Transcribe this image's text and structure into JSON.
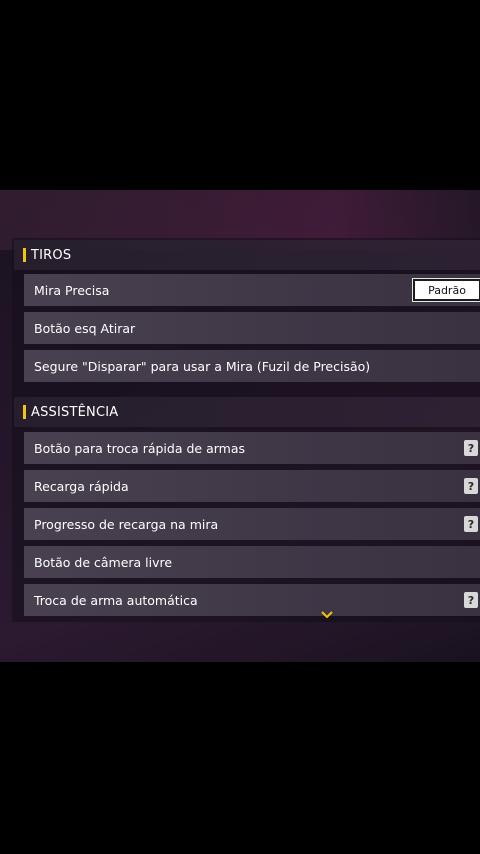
{
  "sections": {
    "shots": {
      "title": "TIROS",
      "rows": [
        {
          "label": "Mira Precisa",
          "dropdown_value": "Padrão"
        },
        {
          "label": "Botão esq Atirar"
        },
        {
          "label": "Segure \"Disparar\" para usar a Mira (Fuzil de Precisão)"
        }
      ]
    },
    "assist": {
      "title": "ASSISTÊNCIA",
      "rows": [
        {
          "label": "Botão para troca rápida de armas",
          "help": "?"
        },
        {
          "label": "Recarga rápida",
          "help": "?"
        },
        {
          "label": "Progresso de recarga na mira",
          "help": "?"
        },
        {
          "label": "Botão de câmera livre"
        },
        {
          "label": "Troca de arma automática",
          "help": "?"
        }
      ]
    }
  },
  "icons": {
    "section_marker": "section-marker-icon",
    "help": "help-icon",
    "scroll_more": "chevron-down-icon"
  },
  "colors": {
    "accent": "#f2c40d",
    "row_bg": "#4a4150",
    "panel_bg": "#24162a"
  }
}
